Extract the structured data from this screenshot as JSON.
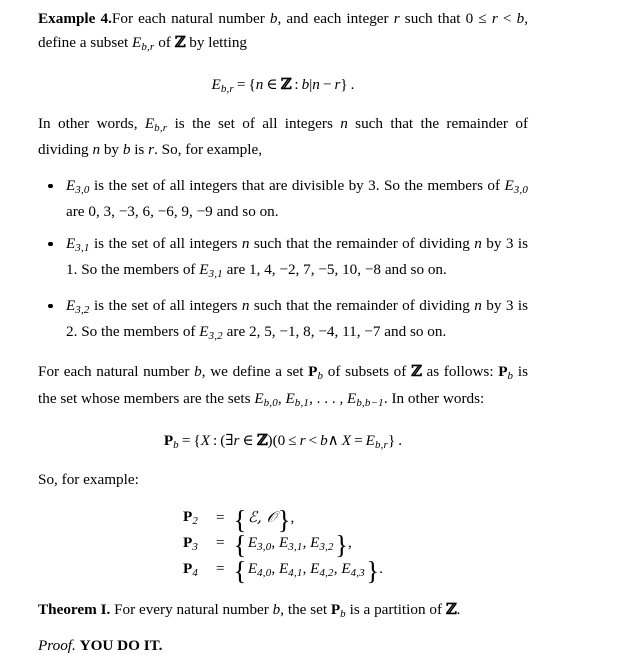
{
  "document": {
    "example": {
      "heading": "Example 4.",
      "intro_part1": "For each natural number ",
      "intro_var_b": "b",
      "intro_part2": ", and each integer ",
      "intro_var_r": "r",
      "intro_part3": " such that 0 ",
      "intro_leq": "≤",
      "intro_part4": " ",
      "intro_r2": "r",
      "intro_lt": " < ",
      "intro_b2": "b",
      "intro_part5": ", define a subset ",
      "intro_E": "E",
      "intro_E_sub": "b,r",
      "intro_part6": " of ",
      "intro_Z": "ℤ",
      "intro_part7": " by letting"
    },
    "display_eq_1": {
      "lhs_symbol": "E",
      "lhs_sub": "b,r",
      "relation": "=",
      "set_open": "{",
      "elem_n": "n",
      "member_sign": "∈",
      "set_Z": "ℤ",
      "colon": ":",
      "divides_b": "b",
      "divides_bar": "|",
      "expr_n": "n",
      "minus": "−",
      "expr_r": "r",
      "set_close": "}",
      "period": "."
    },
    "in_other_words": {
      "part1": "In other words, ",
      "E": "E",
      "E_sub": "b,r",
      "part2": " is the set of all integers ",
      "var_n": "n",
      "part3": " such that the remainder of dividing ",
      "var_n2": "n",
      "part4": " by ",
      "var_b": "b",
      "part5": " is ",
      "var_r": "r",
      "part6": ". So, for example,"
    },
    "bullets": [
      {
        "symbol": "E",
        "sub": "3,0",
        "text_part1": " is the set of all integers that are divisible by 3. So the members of ",
        "symbol2": "E",
        "sub2": "3,0",
        "text_part2": " are ",
        "members": "0, 3, −3, 6, −6, 9, −9",
        "text_part3": " and so on."
      },
      {
        "symbol": "E",
        "sub": "3,1",
        "text_part1": " is the set of all integers ",
        "var_n": "n",
        "text_part2": " such that the remainder of dividing ",
        "var_n2": "n",
        "text_part3": " by 3 is 1. So the members of ",
        "symbol2": "E",
        "sub2": "3,1",
        "text_part4": " are ",
        "members": "1, 4, −2, 7, −5, 10, −8",
        "text_part5": " and so on."
      },
      {
        "symbol": "E",
        "sub": "3,2",
        "text_part1": " is the set of all integers ",
        "var_n": "n",
        "text_part2": " such that the remainder of dividing ",
        "var_n2": "n",
        "text_part3": " by 3 is 2. So the members of ",
        "symbol2": "E",
        "sub2": "3,2",
        "text_part4": " are ",
        "members": "2, 5, −1, 8, −4, 11, −7",
        "text_part5": " and so on."
      }
    ],
    "partition_para": {
      "part1": "For each natural number ",
      "var_b": "b",
      "part2": ", we define a set ",
      "P": "P",
      "P_sub": "b",
      "part3": " of subsets of ",
      "Z": "ℤ",
      "part4": " as follows: ",
      "P2": "P",
      "P2_sub": "b",
      "part5": " is the set whose members are the sets ",
      "E1": "E",
      "E1_sub": "b,0",
      "comma1": ", ",
      "E2": "E",
      "E2_sub": "b,1",
      "ellipsis": ", . . . , ",
      "E3": "E",
      "E3_sub": "b,b−1",
      "part6": ". In other words:"
    },
    "display_eq_2": {
      "lhs_P": "P",
      "lhs_sub": "b",
      "relation": "=",
      "set_open": "{",
      "var_X": "X",
      "colon": ":",
      "paren_open": "(",
      "exists": "∃",
      "var_r": "r",
      "member_sign": "∈",
      "set_Z": "ℤ",
      "paren_close": ")",
      "paren_open2": "(",
      "zero": "0",
      "leq": "≤",
      "var_r2": "r",
      "lt": "<",
      "var_b": "b",
      "and_sign": "∧",
      "var_X2": "X",
      "eq2": "=",
      "E": "E",
      "E_sub": "b,r",
      "set_close": "}",
      "period": "."
    },
    "so_for_example": "So, for example:",
    "aligned_equations": [
      {
        "lhs_P": "P",
        "lhs_sub": "2",
        "relation": "=",
        "members": [
          {
            "type": "script",
            "symbol": "ℰ",
            "sub": ""
          },
          {
            "type": "script",
            "symbol": "ᵊO",
            "sub": ""
          }
        ],
        "members_text": "ℰ, 𝒪",
        "trailing": ","
      },
      {
        "lhs_P": "P",
        "lhs_sub": "3",
        "relation": "=",
        "members_text": "E3,0, E3,1, E3,2",
        "E_list": [
          {
            "symbol": "E",
            "sub": "3,0"
          },
          {
            "symbol": "E",
            "sub": "3,1"
          },
          {
            "symbol": "E",
            "sub": "3,2"
          }
        ],
        "trailing": ","
      },
      {
        "lhs_P": "P",
        "lhs_sub": "4",
        "relation": "=",
        "members_text": "E4,0, E4,1, E4,2, E4,3",
        "E_list": [
          {
            "symbol": "E",
            "sub": "4,0"
          },
          {
            "symbol": "E",
            "sub": "4,1"
          },
          {
            "symbol": "E",
            "sub": "4,2"
          },
          {
            "symbol": "E",
            "sub": "4,3"
          }
        ],
        "trailing": "."
      }
    ],
    "theorem": {
      "heading": "Theorem I.",
      "part1": " For every natural number ",
      "var_b": "b",
      "part2": ", the set ",
      "P": "P",
      "P_sub": "b",
      "part3": " is a partition of ",
      "Z": "ℤ",
      "part4": "."
    },
    "proof": {
      "heading": "Proof.",
      "body": "YOU DO IT."
    }
  }
}
